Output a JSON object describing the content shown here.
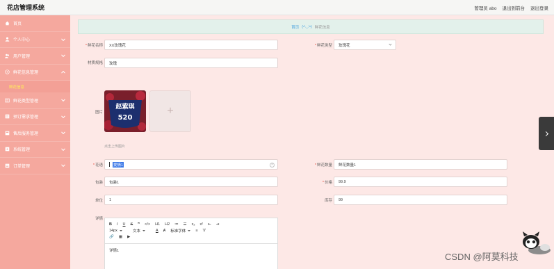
{
  "app": {
    "title": "花店管理系统",
    "top_links": [
      "管理员 abo",
      "退出到前台",
      "退出登录"
    ]
  },
  "sidebar": {
    "items": [
      {
        "label": "首页",
        "icon": "home-icon",
        "expandable": false
      },
      {
        "label": "个人中心",
        "icon": "user-icon",
        "expandable": true
      },
      {
        "label": "用户管理",
        "icon": "users-icon",
        "expandable": true
      },
      {
        "label": "鲜花信息管理",
        "icon": "flower-icon",
        "expandable": true,
        "open": true
      },
      {
        "label": "鲜花类型管理",
        "icon": "tag-icon",
        "expandable": true
      },
      {
        "label": "预订需求管理",
        "icon": "list-icon",
        "expandable": true
      },
      {
        "label": "售后服务管理",
        "icon": "service-icon",
        "expandable": true
      },
      {
        "label": "系统管理",
        "icon": "settings-icon",
        "expandable": true
      },
      {
        "label": "订单管理",
        "icon": "order-icon",
        "expandable": true
      }
    ],
    "submenu": {
      "label": "鲜花信息"
    }
  },
  "breadcrumb": {
    "home": "首页",
    "separator": "(•'◡'•)",
    "current": "鲜花信息"
  },
  "form": {
    "flower_name": {
      "label": "鲜花名称",
      "value": "XX玫瑰花",
      "required": true
    },
    "flower_type": {
      "label": "鲜花类型",
      "value": "玫瑰花",
      "required": true
    },
    "material": {
      "label": "材质规格",
      "value": "玫瑰"
    },
    "image": {
      "label": "图片",
      "tip": "点击上传图片",
      "thumb_text": "赵紫琪\n520"
    },
    "language": {
      "label": "花语",
      "value": "爱情1"
    },
    "quantity": {
      "label": "鲜花数量",
      "value": "鲜花数量1",
      "required": true
    },
    "packaging": {
      "label": "包装",
      "value": "包装1"
    },
    "price": {
      "label": "价格",
      "value": "99.9",
      "required": true
    },
    "unit": {
      "label": "单位",
      "value": "1"
    },
    "stock": {
      "label": "库存",
      "value": "99"
    },
    "detail": {
      "label": "详情",
      "value": "详情1"
    }
  },
  "editor": {
    "toolbar_row1": [
      "B",
      "I",
      "U",
      "S",
      "❞",
      "</>",
      "H1",
      "H2",
      "≔",
      "☰",
      "x₂",
      "x²",
      "⇤",
      "⇥"
    ],
    "toolbar_row2": [
      {
        "label": "14px",
        "select": true
      },
      {
        "label": "文本",
        "select": true
      },
      "A",
      "Ⱥ",
      {
        "label": "标准字体",
        "select": true
      },
      "≡",
      "T̸"
    ],
    "toolbar_row3": [
      "🔗",
      "▦",
      "▶"
    ]
  },
  "watermark": "CSDN @阿莫科技",
  "colors": {
    "sidebar": "#f5a89e",
    "page": "#fde8e6",
    "breadcrumb": "#e3f1eb",
    "accent": "#4aa3df",
    "submenu_active": "#ffee58"
  }
}
